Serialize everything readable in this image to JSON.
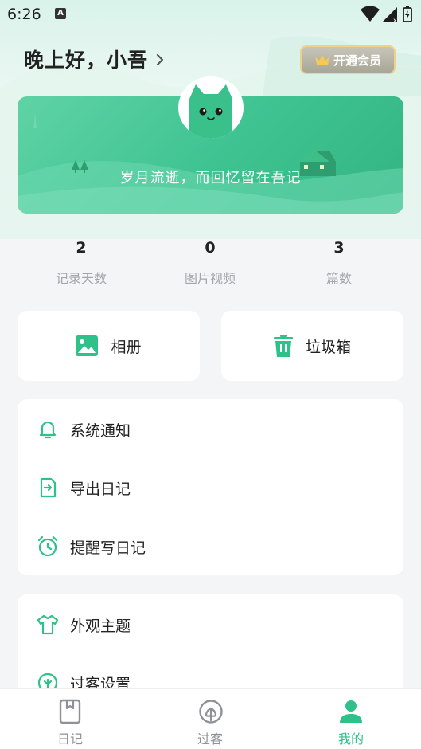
{
  "status_bar": {
    "time": "6:26",
    "notification_letter": "A"
  },
  "header": {
    "greeting": "晚上好，小吾",
    "vip_button_label": "开通会员"
  },
  "banner": {
    "slogan": "岁月流逝，而回忆留在吾记"
  },
  "stats": [
    {
      "value": "2",
      "label": "记录天数"
    },
    {
      "value": "0",
      "label": "图片视频"
    },
    {
      "value": "3",
      "label": "篇数"
    }
  ],
  "quick_actions": {
    "album_label": "相册",
    "trash_label": "垃圾箱"
  },
  "menu_group_1": [
    {
      "label": "系统通知",
      "icon": "bell-icon"
    },
    {
      "label": "导出日记",
      "icon": "export-icon"
    },
    {
      "label": "提醒写日记",
      "icon": "alarm-clock-icon"
    }
  ],
  "menu_group_2": [
    {
      "label": "外观主题",
      "icon": "tshirt-icon"
    },
    {
      "label": "过客设置",
      "icon": "leaf-icon"
    }
  ],
  "bottom_nav": [
    {
      "label": "日记",
      "icon": "diary-icon",
      "active": false
    },
    {
      "label": "过客",
      "icon": "leaf-icon",
      "active": false
    },
    {
      "label": "我的",
      "icon": "user-icon",
      "active": true
    }
  ],
  "colors": {
    "accent": "#2fc18a",
    "banner": "#3dc290",
    "gold": "#f1d08a"
  }
}
